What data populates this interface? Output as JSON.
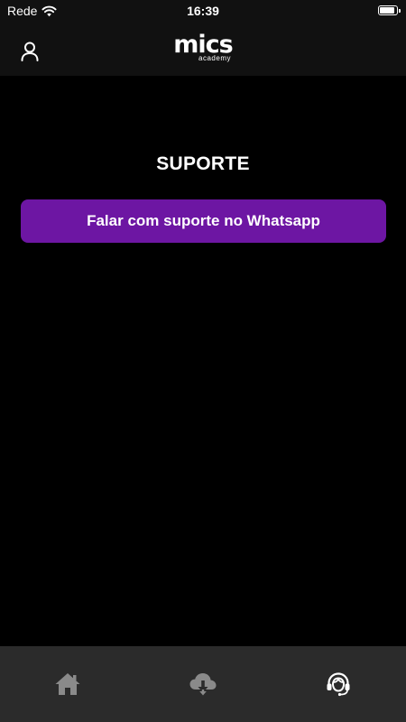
{
  "status_bar": {
    "carrier": "Rede",
    "time": "16:39"
  },
  "header": {
    "logo_main": "mics",
    "logo_sub": "academy",
    "profile_icon": "user-icon"
  },
  "main": {
    "title": "SUPORTE",
    "whatsapp_button_label": "Falar com suporte no Whatsapp"
  },
  "tab_bar": {
    "items": [
      {
        "icon": "home-icon",
        "active": false
      },
      {
        "icon": "cloud-download-icon",
        "active": false
      },
      {
        "icon": "headset-support-icon",
        "active": true
      }
    ]
  },
  "colors": {
    "background": "#000000",
    "header_background": "#111111",
    "accent_purple": "#6d16a3",
    "tab_bar_background": "#2b2b2b",
    "tab_inactive": "#8a8a8a",
    "tab_active": "#ffffff"
  }
}
